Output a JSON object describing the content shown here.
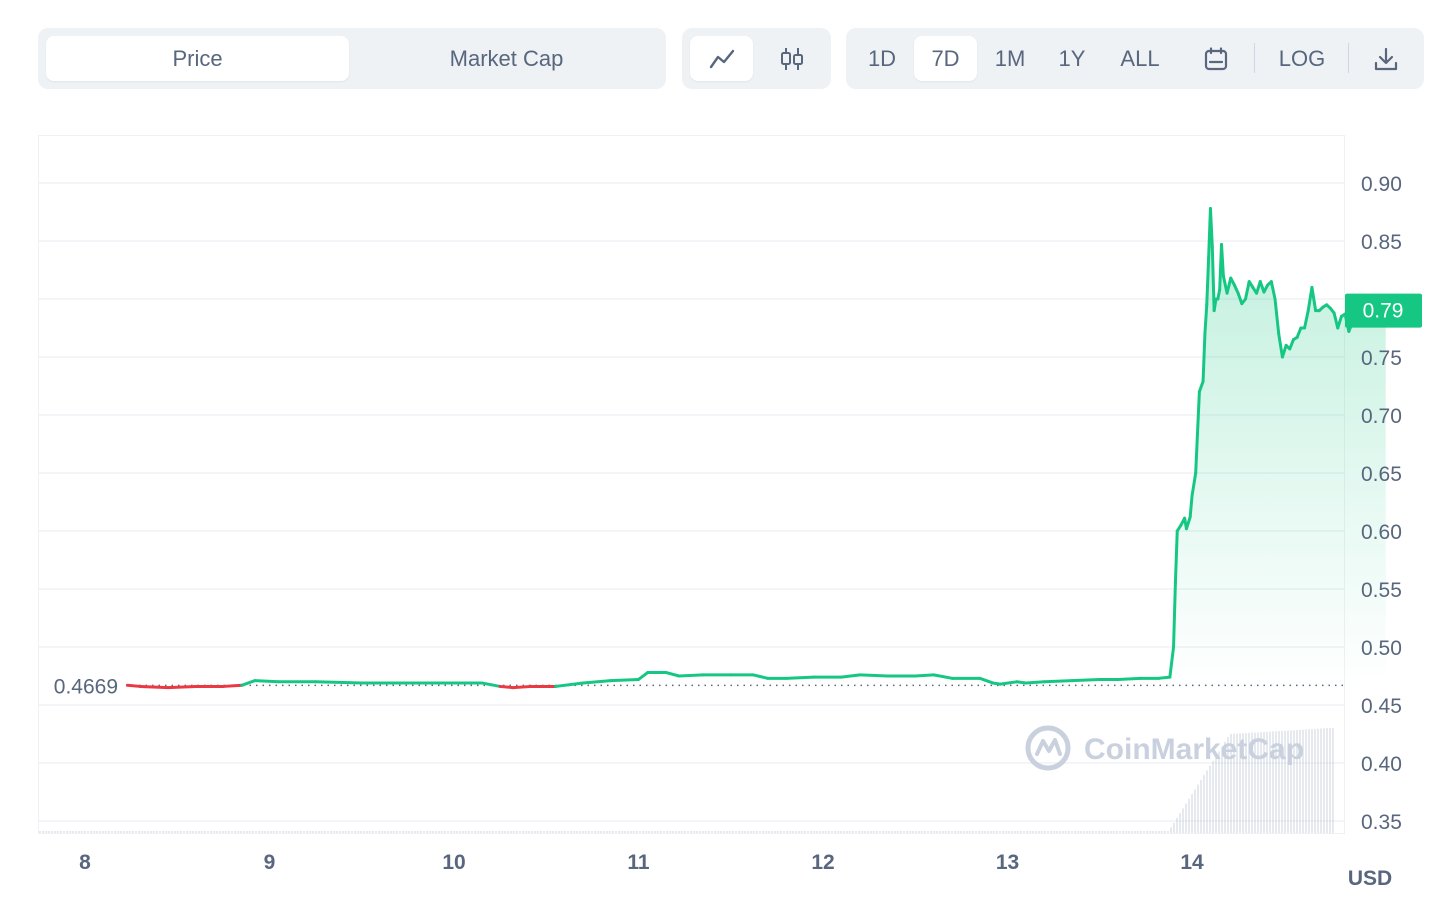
{
  "toolbar": {
    "metric_tabs": [
      {
        "label": "Price",
        "active": true
      },
      {
        "label": "Market Cap",
        "active": false
      }
    ],
    "chart_styles": [
      {
        "icon": "line-chart-icon",
        "active": true
      },
      {
        "icon": "candlestick-icon",
        "active": false
      }
    ],
    "ranges": [
      {
        "label": "1D",
        "active": false
      },
      {
        "label": "7D",
        "active": true
      },
      {
        "label": "1M",
        "active": false
      },
      {
        "label": "1Y",
        "active": false
      },
      {
        "label": "ALL",
        "active": false
      }
    ],
    "calendar_icon": "calendar-icon",
    "log_label": "LOG",
    "download_icon": "download-icon"
  },
  "chart_data": {
    "type": "line",
    "currency_label": "USD",
    "watermark": "CoinMarketCap",
    "reference_value": "0.4669",
    "current_value": "0.79",
    "y_ticks": [
      "0.90",
      "0.85",
      "0.75",
      "0.70",
      "0.65",
      "0.60",
      "0.55",
      "0.50",
      "0.45",
      "0.40",
      "0.35"
    ],
    "ylim": [
      0.337,
      0.947
    ],
    "x_ticks": [
      "8",
      "9",
      "10",
      "11",
      "12",
      "13",
      "14"
    ],
    "xlim": [
      7.7,
      14.8
    ],
    "grid": true,
    "colors": {
      "up": "#16c784",
      "down": "#ea3943",
      "text": "#58667e",
      "grid": "#eff2f5",
      "volume": "#a6b0c3"
    },
    "series": [
      {
        "points": [
          [
            8.23,
            0.467
          ],
          [
            8.3,
            0.466
          ],
          [
            8.45,
            0.465
          ],
          [
            8.6,
            0.466
          ],
          [
            8.75,
            0.466
          ],
          [
            8.85,
            0.467
          ],
          [
            8.92,
            0.471
          ],
          [
            9.05,
            0.47
          ],
          [
            9.25,
            0.47
          ],
          [
            9.5,
            0.469
          ],
          [
            9.75,
            0.469
          ],
          [
            9.95,
            0.469
          ],
          [
            10.15,
            0.469
          ],
          [
            10.25,
            0.466
          ],
          [
            10.32,
            0.465
          ],
          [
            10.42,
            0.466
          ],
          [
            10.55,
            0.466
          ],
          [
            10.7,
            0.469
          ],
          [
            10.85,
            0.471
          ],
          [
            11.0,
            0.472
          ],
          [
            11.05,
            0.478
          ],
          [
            11.15,
            0.478
          ],
          [
            11.22,
            0.475
          ],
          [
            11.35,
            0.476
          ],
          [
            11.5,
            0.476
          ],
          [
            11.62,
            0.476
          ],
          [
            11.7,
            0.473
          ],
          [
            11.8,
            0.473
          ],
          [
            11.95,
            0.474
          ],
          [
            12.1,
            0.474
          ],
          [
            12.2,
            0.476
          ],
          [
            12.35,
            0.475
          ],
          [
            12.5,
            0.475
          ],
          [
            12.6,
            0.476
          ],
          [
            12.7,
            0.473
          ],
          [
            12.85,
            0.473
          ],
          [
            12.92,
            0.469
          ],
          [
            12.96,
            0.468
          ],
          [
            13.05,
            0.47
          ],
          [
            13.1,
            0.469
          ],
          [
            13.2,
            0.47
          ],
          [
            13.35,
            0.471
          ],
          [
            13.5,
            0.472
          ],
          [
            13.6,
            0.472
          ],
          [
            13.72,
            0.473
          ],
          [
            13.82,
            0.473
          ],
          [
            13.88,
            0.474
          ],
          [
            13.9,
            0.5
          ],
          [
            13.91,
            0.555
          ],
          [
            13.92,
            0.6
          ],
          [
            13.94,
            0.605
          ],
          [
            13.96,
            0.611
          ],
          [
            13.97,
            0.602
          ],
          [
            13.99,
            0.612
          ],
          [
            14.0,
            0.63
          ],
          [
            14.02,
            0.65
          ],
          [
            14.04,
            0.72
          ],
          [
            14.06,
            0.729
          ],
          [
            14.07,
            0.77
          ],
          [
            14.08,
            0.795
          ],
          [
            14.09,
            0.835
          ],
          [
            14.1,
            0.878
          ],
          [
            14.11,
            0.845
          ],
          [
            14.12,
            0.79
          ],
          [
            14.13,
            0.8
          ],
          [
            14.14,
            0.8
          ],
          [
            14.15,
            0.808
          ],
          [
            14.16,
            0.847
          ],
          [
            14.17,
            0.82
          ],
          [
            14.19,
            0.805
          ],
          [
            14.21,
            0.818
          ],
          [
            14.23,
            0.812
          ],
          [
            14.25,
            0.805
          ],
          [
            14.27,
            0.796
          ],
          [
            14.29,
            0.8
          ],
          [
            14.31,
            0.815
          ],
          [
            14.33,
            0.81
          ],
          [
            14.35,
            0.805
          ],
          [
            14.37,
            0.815
          ],
          [
            14.39,
            0.806
          ],
          [
            14.41,
            0.812
          ],
          [
            14.43,
            0.815
          ],
          [
            14.45,
            0.8
          ],
          [
            14.47,
            0.77
          ],
          [
            14.49,
            0.75
          ],
          [
            14.51,
            0.76
          ],
          [
            14.53,
            0.757
          ],
          [
            14.55,
            0.765
          ],
          [
            14.57,
            0.767
          ],
          [
            14.59,
            0.775
          ],
          [
            14.61,
            0.775
          ],
          [
            14.63,
            0.79
          ],
          [
            14.65,
            0.81
          ],
          [
            14.67,
            0.79
          ],
          [
            14.69,
            0.79
          ],
          [
            14.71,
            0.793
          ],
          [
            14.73,
            0.795
          ],
          [
            14.75,
            0.792
          ],
          [
            14.77,
            0.788
          ],
          [
            14.79,
            0.775
          ],
          [
            14.81,
            0.785
          ],
          [
            14.83,
            0.787
          ],
          [
            14.85,
            0.772
          ],
          [
            14.87,
            0.78
          ],
          [
            14.89,
            0.781
          ],
          [
            14.91,
            0.79
          ],
          [
            14.93,
            0.792
          ],
          [
            14.95,
            0.791
          ],
          [
            14.97,
            0.788
          ],
          [
            14.99,
            0.79
          ],
          [
            15.0,
            0.8
          ],
          [
            15.02,
            0.794
          ],
          [
            15.04,
            0.795
          ],
          [
            15.05,
            0.79
          ]
        ]
      }
    ]
  }
}
